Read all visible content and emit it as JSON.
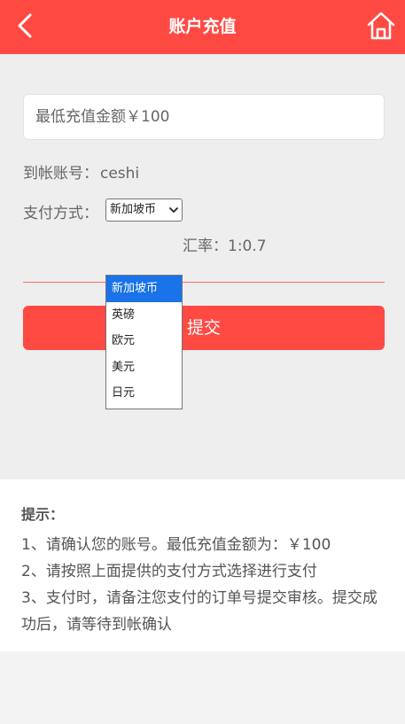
{
  "header": {
    "title": "账户充值",
    "accent_color": "#ff4a44",
    "back_icon": "chevron-left-icon",
    "home_icon": "home-icon"
  },
  "form": {
    "amount_placeholder": "最低充值金额￥100",
    "account_label": "到帐账号：",
    "account_value": "ceshi",
    "payment_label": "支付方式：",
    "payment_selected": "新加坡币",
    "payment_options": [
      "新加坡币",
      "英磅",
      "欧元",
      "美元",
      "日元"
    ],
    "rate_text": "汇率：1:0.7",
    "submit_label": "提交"
  },
  "tips": {
    "heading": "提示：",
    "lines": [
      "1、请确认您的账号。最低充值金额为：￥100",
      "2、请按照上面提供的支付方式选择进行支付",
      "3、支付时，请备注您支付的订单号提交审核。提交成功后，请等待到帐确认"
    ]
  }
}
